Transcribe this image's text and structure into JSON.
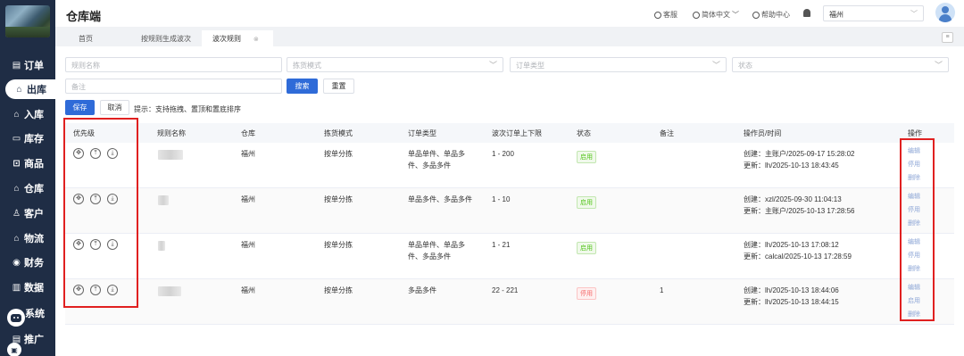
{
  "sidebar": {
    "items": [
      {
        "label": "订单",
        "icon": "receipt-icon",
        "glyph": "▤"
      },
      {
        "label": "出库",
        "icon": "outbound-icon",
        "glyph": "⌂"
      },
      {
        "label": "入库",
        "icon": "inbound-icon",
        "glyph": "⌂"
      },
      {
        "label": "库存",
        "icon": "inventory-icon",
        "glyph": "▭"
      },
      {
        "label": "商品",
        "icon": "goods-icon",
        "glyph": "⊡"
      },
      {
        "label": "仓库",
        "icon": "warehouse-icon",
        "glyph": "⌂"
      },
      {
        "label": "客户",
        "icon": "customer-icon",
        "glyph": "♙"
      },
      {
        "label": "物流",
        "icon": "logistics-icon",
        "glyph": "⌂"
      },
      {
        "label": "财务",
        "icon": "finance-icon",
        "glyph": "◉"
      },
      {
        "label": "数据",
        "icon": "chart-icon",
        "glyph": "▥"
      },
      {
        "label": "系统",
        "icon": "system-icon",
        "glyph": ""
      },
      {
        "label": "推广",
        "icon": "promotion-icon",
        "glyph": "▤"
      }
    ],
    "active_index": 1
  },
  "header": {
    "title": "仓库端",
    "service": "客服",
    "language": "简体中文",
    "help": "帮助中心",
    "warehouse_value": "福州"
  },
  "tabs": [
    {
      "label": "首页"
    },
    {
      "label": "按规则生成波次"
    },
    {
      "label": "波次规则",
      "close": "⊗"
    }
  ],
  "filters": {
    "rule_name_placeholder": "规则名称",
    "pick_mode_placeholder": "拣货模式",
    "order_type_placeholder": "订单类型",
    "status_placeholder": "状态",
    "remark_placeholder": "备注",
    "search_label": "搜索",
    "reset_label": "重置"
  },
  "actions": {
    "save_label": "保存",
    "cancel_label": "取消",
    "tip": "提示：支持拖拽、置顶和置底排序"
  },
  "table": {
    "headers": [
      "优先级",
      "规则名称",
      "仓库",
      "拣货模式",
      "订单类型",
      "波次订单上下限",
      "状态",
      "备注",
      "操作员/时间",
      "操作"
    ],
    "rows": [
      {
        "warehouse": "福州",
        "pick_mode": "按单分拣",
        "order_type_1": "单品单件、单品多",
        "order_type_2": "件、多品多件",
        "limit": "1 - 200",
        "status": "启用",
        "status_kind": "on",
        "remark": "",
        "created": "创建：主账户/2025-09-17 15:28:02",
        "updated": "更新：lh/2025-10-13 18:43:45",
        "ops": [
          "编辑",
          "停用",
          "删除"
        ]
      },
      {
        "warehouse": "福州",
        "pick_mode": "按单分拣",
        "order_type_1": "单品多件、多品多件",
        "order_type_2": "",
        "limit": "1 - 10",
        "status": "启用",
        "status_kind": "on",
        "remark": "",
        "created": "创建：xzl/2025-09-30 11:04:13",
        "updated": "更新：主账户/2025-10-13 17:28:56",
        "ops": [
          "编辑",
          "停用",
          "删除"
        ]
      },
      {
        "warehouse": "福州",
        "pick_mode": "按单分拣",
        "order_type_1": "单品单件、单品多",
        "order_type_2": "件、多品多件",
        "limit": "1 - 21",
        "status": "启用",
        "status_kind": "on",
        "remark": "",
        "created": "创建：lh/2025-10-13 17:08:12",
        "updated": "更新：calcal/2025-10-13 17:28:59",
        "ops": [
          "编辑",
          "停用",
          "删除"
        ]
      },
      {
        "warehouse": "福州",
        "pick_mode": "按单分拣",
        "order_type_1": "多品多件",
        "order_type_2": "",
        "limit": "22 - 221",
        "status": "停用",
        "status_kind": "off",
        "remark": "1",
        "created": "创建：lh/2025-10-13 18:44:06",
        "updated": "更新：lh/2025-10-13 18:44:15",
        "ops": [
          "编辑",
          "启用",
          "删除"
        ]
      }
    ],
    "priority_controls": [
      {
        "icon": "drag-move-icon",
        "glyph": "✥"
      },
      {
        "icon": "move-to-top-icon",
        "glyph": "⤒"
      },
      {
        "icon": "move-to-bottom-icon",
        "glyph": "⤓"
      }
    ]
  },
  "colors": {
    "sidebar_bg": "#1f2d45",
    "primary": "#2f6bd8",
    "enabled": "#52c41a",
    "disabled": "#f56c6c",
    "link": "#8da6d6",
    "highlight_box": "#e02020"
  }
}
